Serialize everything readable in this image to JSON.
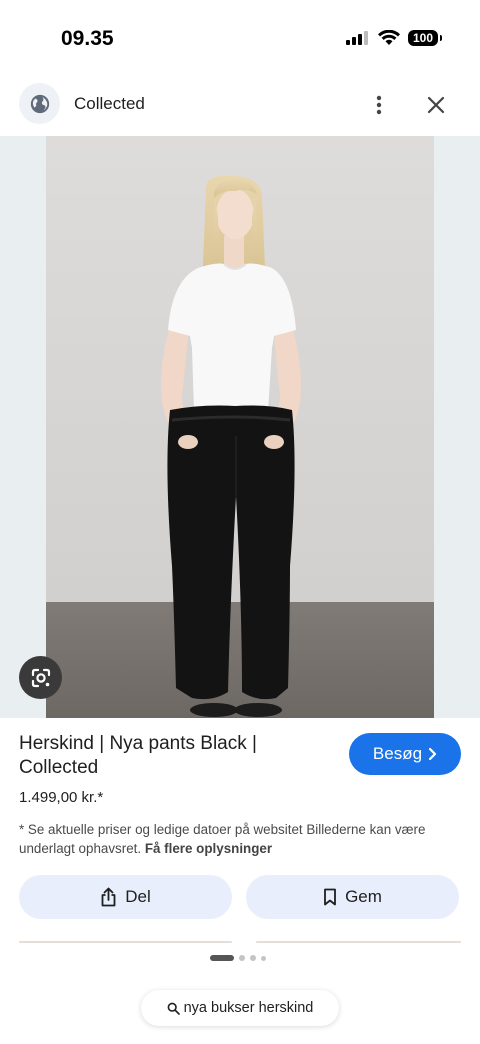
{
  "status_bar": {
    "time": "09.35",
    "battery": "100"
  },
  "header": {
    "title": "Collected"
  },
  "product": {
    "title": "Herskind | Nya pants Black | Collected",
    "price": "1.499,00 kr.*",
    "visit_label": "Besøg",
    "disclaimer": "* Se aktuelle priser og ledige datoer på websitet Billederne kan være underlagt ophavsret.",
    "more_info_link": "Få flere oplysninger"
  },
  "actions": {
    "share_label": "Del",
    "save_label": "Gem"
  },
  "pager": {
    "total": 4,
    "active": 1
  },
  "search": {
    "query": "nya bukser herskind"
  },
  "colors": {
    "accent": "#1a73e8",
    "chip_bg": "#e8eefb",
    "image_bg": "#e9eef0"
  },
  "icons": {
    "globe": "globe-icon",
    "more": "more-vert-icon",
    "close": "close-icon",
    "lens": "google-lens-icon",
    "share": "share-icon",
    "bookmark": "bookmark-icon",
    "search": "search-icon",
    "chevron": "chevron-right-icon"
  }
}
